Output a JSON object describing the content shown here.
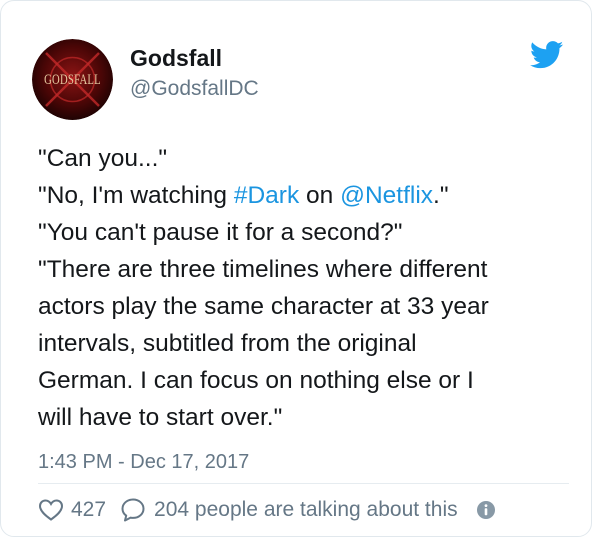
{
  "tweet": {
    "avatar_text": "GODSFALL",
    "display_name": "Godsfall",
    "handle": "@GodsfallDC",
    "brand_icon": "twitter-bird-icon",
    "accent_color": "#1b95e0",
    "body": {
      "line1": "\"Can you...\"",
      "line2_pre": "\"No, I'm watching ",
      "line2_hashtag": "#Dark",
      "line2_mid": " on ",
      "line2_mention": "@Netflix",
      "line2_post": ".\"",
      "line3": "\"You can't pause it for a second?\"",
      "line4": "\"There are three timelines where different",
      "line5": "actors play the same character at 33 year",
      "line6": "intervals, subtitled from the original",
      "line7": "German. I can focus on nothing else or I",
      "line8": "will have to start over.\""
    },
    "timestamp": "1:43 PM - Dec 17, 2017",
    "likes": "427",
    "talking": "204 people are talking about this"
  }
}
